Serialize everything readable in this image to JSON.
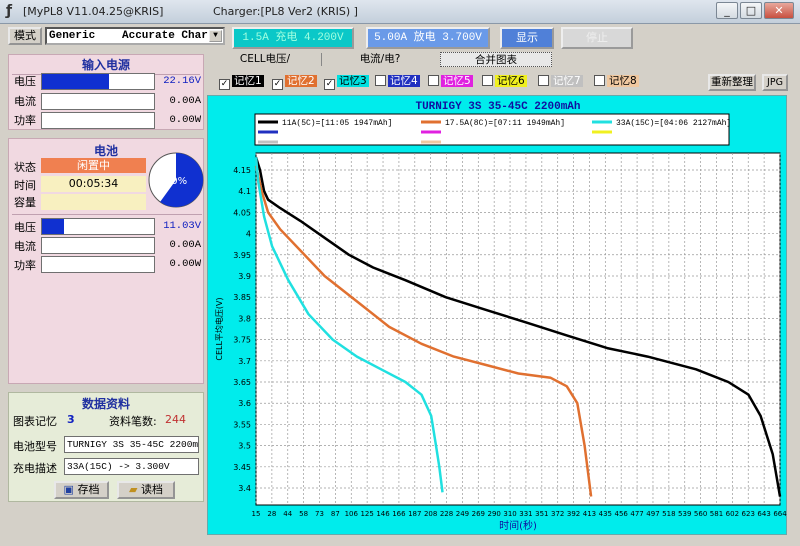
{
  "window": {
    "title": "[MyPL8 V11.04.25@KRIS]",
    "charger": "Charger:[PL8 Ver2 (KRIS) ]"
  },
  "toolbar": {
    "mode_label": "模式",
    "profile_left": "Generic",
    "profile_right": "Accurate Char",
    "charge_btn": "1.5A 充电 4.200V",
    "discharge_btn": "5.00A 放电 3.700V",
    "display_btn": "显示",
    "stop_btn": "停止"
  },
  "input_power": {
    "title": "输入电源",
    "rows": [
      {
        "label": "电压",
        "value": "22.16V",
        "level": 0.6
      },
      {
        "label": "电流",
        "value": "0.00A"
      },
      {
        "label": "功率",
        "value": "0.00W"
      }
    ]
  },
  "battery": {
    "title": "电池",
    "status_label": "状态",
    "status_value": "闲置中",
    "time_label": "时间",
    "time_value": "00:05:34",
    "capacity_label": "容量",
    "pie_percent": "60%",
    "pie_fraction": 0.6,
    "rows": [
      {
        "label": "电压",
        "value": "11.03V",
        "level": 0.2
      },
      {
        "label": "电流",
        "value": "0.00A"
      },
      {
        "label": "功率",
        "value": "0.00W"
      }
    ]
  },
  "data_info": {
    "title": "数据资料",
    "chart_mem_label": "图表记忆",
    "chart_mem_value": "3",
    "record_count_label": "资料笔数:",
    "record_count_value": "244",
    "battery_type_label": "电池型号",
    "battery_type_value": "TURNIGY 3S 35-45C 2200mAh",
    "charge_desc_label": "充电描述",
    "charge_desc_value": "33A(15C) -> 3.300V",
    "save_btn": "存档",
    "load_btn": "读档"
  },
  "tabs": [
    "CELL电压/",
    "电流/电?",
    "合并图表"
  ],
  "memories": [
    {
      "label": "记忆1",
      "checked": true,
      "bg": "#000000",
      "fg": "#ffffff"
    },
    {
      "label": "记忆2",
      "checked": true,
      "bg": "#e07030",
      "fg": "#ffffff"
    },
    {
      "label": "记忆3",
      "checked": true,
      "bg": "#00e0e0",
      "fg": "#000000"
    },
    {
      "label": "记忆4",
      "checked": false,
      "bg": "#2030c0",
      "fg": "#ffffff"
    },
    {
      "label": "记忆5",
      "checked": false,
      "bg": "#e020e0",
      "fg": "#ffffff"
    },
    {
      "label": "记忆6",
      "checked": false,
      "bg": "#f0f020",
      "fg": "#000000"
    },
    {
      "label": "记忆7",
      "checked": false,
      "bg": "#c0c0c0",
      "fg": "#ffffff"
    },
    {
      "label": "记忆8",
      "checked": false,
      "bg": "#f0c8a0",
      "fg": "#000000"
    }
  ],
  "rearrange_btn": "重新整理",
  "jpg_btn": "JPG",
  "chart_data": {
    "type": "line",
    "title": "TURNIGY 3S 35-45C 2200mAh",
    "xlabel": "时间(秒)",
    "ylabel": "CELL平均电压(V)",
    "xlim": [
      15,
      664
    ],
    "ylim": [
      3.36,
      4.19
    ],
    "x_ticks": [
      "15",
      "28",
      "44",
      "58",
      "73",
      "87",
      "106",
      "125",
      "146",
      "166",
      "187",
      "208",
      "228",
      "249",
      "269",
      "290",
      "310",
      "331",
      "351",
      "372",
      "392",
      "413",
      "435",
      "456",
      "477",
      "497",
      "518",
      "539",
      "560",
      "581",
      "602",
      "623",
      "643",
      "664"
    ],
    "y_ticks": [
      3.4,
      3.45,
      3.5,
      3.55,
      3.6,
      3.65,
      3.7,
      3.75,
      3.8,
      3.85,
      3.9,
      3.95,
      4.0,
      4.05,
      4.1,
      4.15
    ],
    "legend": [
      "11A(5C)=[11:05 1947mAh]",
      "17.5A(8C)=[07:11 1949mAh]",
      "33A(15C)=[04:06 2127mAh]"
    ],
    "series": [
      {
        "name": "11A(5C)=[11:05 1947mAh]",
        "color": "#000000",
        "points": [
          [
            15,
            4.18
          ],
          [
            20,
            4.15
          ],
          [
            25,
            4.1
          ],
          [
            30,
            4.08
          ],
          [
            45,
            4.06
          ],
          [
            70,
            4.03
          ],
          [
            100,
            3.99
          ],
          [
            130,
            3.95
          ],
          [
            160,
            3.92
          ],
          [
            200,
            3.89
          ],
          [
            250,
            3.85
          ],
          [
            300,
            3.82
          ],
          [
            350,
            3.79
          ],
          [
            400,
            3.76
          ],
          [
            450,
            3.73
          ],
          [
            500,
            3.71
          ],
          [
            560,
            3.68
          ],
          [
            600,
            3.65
          ],
          [
            625,
            3.62
          ],
          [
            640,
            3.57
          ],
          [
            655,
            3.48
          ],
          [
            664,
            3.38
          ]
        ]
      },
      {
        "name": "17.5A(8C)=[07:11 1949mAh]",
        "color": "#e07030",
        "points": [
          [
            15,
            4.16
          ],
          [
            22,
            4.1
          ],
          [
            30,
            4.05
          ],
          [
            45,
            4.01
          ],
          [
            70,
            3.96
          ],
          [
            100,
            3.9
          ],
          [
            140,
            3.84
          ],
          [
            180,
            3.78
          ],
          [
            220,
            3.74
          ],
          [
            260,
            3.71
          ],
          [
            300,
            3.69
          ],
          [
            340,
            3.67
          ],
          [
            380,
            3.66
          ],
          [
            400,
            3.64
          ],
          [
            413,
            3.6
          ],
          [
            422,
            3.5
          ],
          [
            430,
            3.38
          ]
        ]
      },
      {
        "name": "33A(15C)=[04:06 2127mAh]",
        "color": "#20e0e0",
        "points": [
          [
            15,
            4.18
          ],
          [
            18,
            4.12
          ],
          [
            25,
            4.04
          ],
          [
            35,
            3.97
          ],
          [
            55,
            3.89
          ],
          [
            80,
            3.81
          ],
          [
            110,
            3.75
          ],
          [
            140,
            3.71
          ],
          [
            170,
            3.68
          ],
          [
            200,
            3.65
          ],
          [
            220,
            3.62
          ],
          [
            232,
            3.57
          ],
          [
            238,
            3.5
          ],
          [
            242,
            3.45
          ],
          [
            246,
            3.39
          ]
        ]
      }
    ],
    "grid": true,
    "legend_placement": "top"
  }
}
